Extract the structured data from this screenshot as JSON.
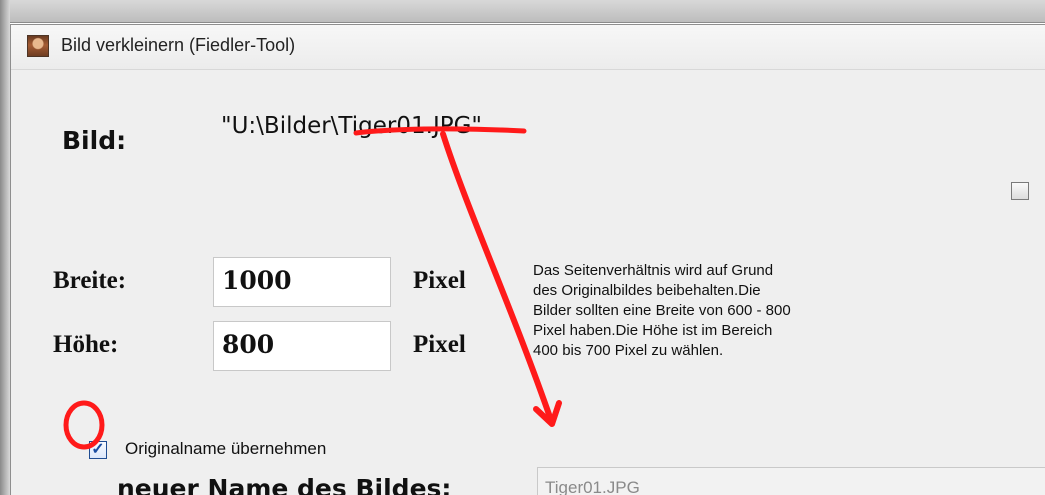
{
  "window": {
    "title": "Bild verkleinern (Fiedler-Tool)",
    "icon": "portrait-photo-icon"
  },
  "image": {
    "label": "Bild:",
    "path": "\"U:\\Bilder\\Tiger01.JPG\""
  },
  "size": {
    "width_label": "Breite:",
    "width_value": "1000",
    "width_unit": "Pixel",
    "height_label": "Höhe:",
    "height_value": "800",
    "height_unit": "Pixel",
    "info_lines": [
      "Das Seitenverhältnis wird auf Grund",
      "des Originalbildes beibehalten.Die",
      "Bilder sollten eine Breite von 600 - 800",
      "Pixel haben.Die Höhe ist im Bereich",
      "400 bis 700 Pixel zu wählen."
    ]
  },
  "options": {
    "aspect_checkbox_checked": false,
    "keep_original_label": "Originalname übernehmen",
    "keep_original_checked": true
  },
  "new_name": {
    "label": "neuer Name des Bildes:",
    "value": "Tiger01.JPG"
  },
  "annotations": {
    "color": "#ff0000"
  }
}
